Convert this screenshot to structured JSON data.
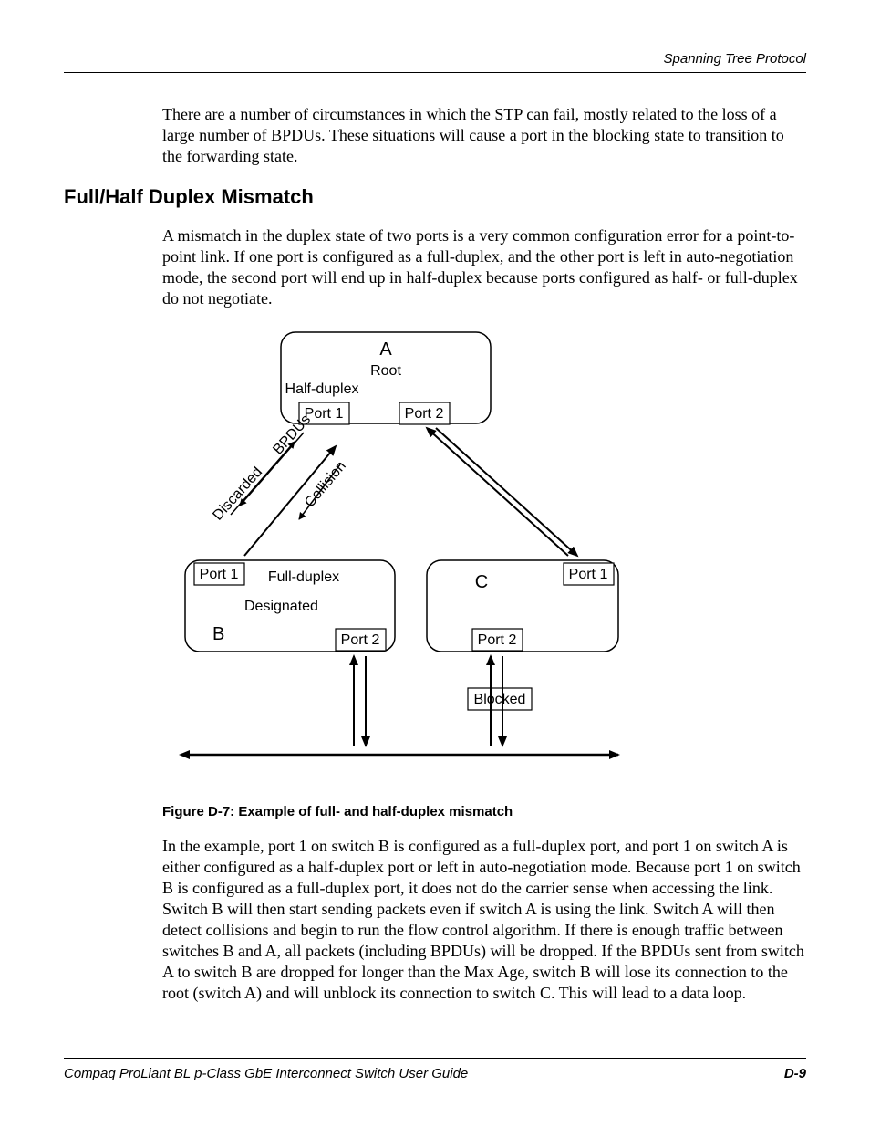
{
  "header": {
    "running": "Spanning Tree Protocol"
  },
  "intro": {
    "p1": "There are a number of circumstances in which the STP can fail, mostly related to the loss of a large number of BPDUs. These situations will cause a port in the blocking state to transition to the forwarding state."
  },
  "section": {
    "title": "Full/Half Duplex Mismatch",
    "p1": "A mismatch in the duplex state of two ports is a very common configuration error for a point-to-point link. If one port is configured as a full-duplex, and the other port is left in auto-negotiation mode, the second port will end up in half-duplex because ports configured as half- or full-duplex do not negotiate."
  },
  "figure": {
    "caption": "Figure D-7:  Example of full- and half-duplex mismatch",
    "labels": {
      "A": "A",
      "root": "Root",
      "half": "Half-duplex",
      "p1": "Port 1",
      "p2": "Port 2",
      "bpdus": "BPDUs",
      "discarded": "Discarded",
      "collision": "Collision",
      "full": "Full-duplex",
      "designated": "Designated",
      "B": "B",
      "C": "C",
      "blocked": "Blocked"
    }
  },
  "post": {
    "p1": "In the example, port 1 on switch B is configured as a full-duplex port, and port 1 on switch A is either configured as a half-duplex port or left in auto-negotiation mode. Because port 1 on switch B is configured as a full-duplex port, it does not do the carrier sense when accessing the link. Switch B will then start sending packets even if switch A is using the link. Switch A will then detect collisions and begin to run the flow control algorithm. If there is enough traffic between switches B and A, all packets (including BPDUs) will be dropped. If the BPDUs sent from switch A to switch B are dropped for longer than the Max Age, switch B will lose its connection to the root (switch A) and will unblock its connection to switch C. This will lead to a data loop."
  },
  "footer": {
    "guide": "Compaq ProLiant BL p-Class GbE Interconnect Switch User Guide",
    "page": "D-9"
  }
}
